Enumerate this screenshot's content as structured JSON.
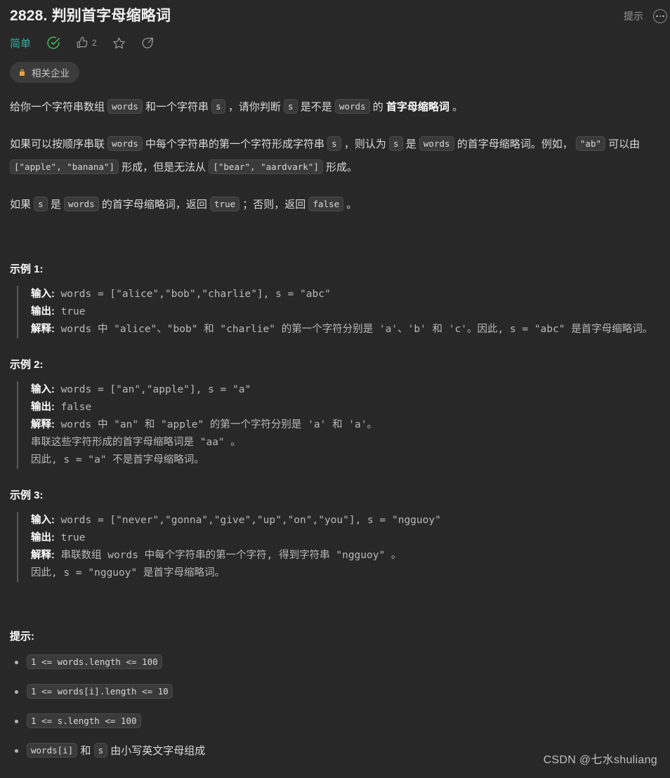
{
  "header": {
    "title": "2828. 判别首字母缩略词",
    "hint_label": "提示",
    "more_icon": "more-dots-icon"
  },
  "meta": {
    "difficulty": "简单",
    "solved_icon": "check-circle-icon",
    "like_icon": "thumbs-up-icon",
    "like_count": "2",
    "favorite_icon": "star-icon",
    "share_icon": "share-icon"
  },
  "company_tag": {
    "lock_icon": "lock-icon",
    "label": "相关企业"
  },
  "description": {
    "p1": {
      "t1": "给你一个字符串数组 ",
      "c1": "words",
      "t2": " 和一个字符串 ",
      "c2": "s",
      "t3": " ，请你判断 ",
      "c3": "s",
      "t4": " 是不是 ",
      "c4": "words",
      "t5": " 的 ",
      "bold": "首字母缩略词",
      "t6": " 。"
    },
    "p2": {
      "t1": "如果可以按顺序串联 ",
      "c1": "words",
      "t2": " 中每个字符串的第一个字符形成字符串 ",
      "c2": "s",
      "t3": " ，则认为 ",
      "c3": "s",
      "t4": " 是 ",
      "c4": "words",
      "t5": " 的首字母缩略词。例如， ",
      "c5": "\"ab\"",
      "t6": " 可以由 ",
      "c6": "[\"apple\", \"banana\"]",
      "t7": " 形成，但是无法从 ",
      "c7": "[\"bear\", \"aardvark\"]",
      "t8": " 形成。"
    },
    "p3": {
      "t1": "如果 ",
      "c1": "s",
      "t2": " 是 ",
      "c2": "words",
      "t3": " 的首字母缩略词，返回 ",
      "c3": "true",
      "t4": " ；否则，返回 ",
      "c4": "false",
      "t5": " 。"
    }
  },
  "examples": [
    {
      "title": "示例 1:",
      "input_label": "输入:",
      "input_value": " words = [\"alice\",\"bob\",\"charlie\"], s = \"abc\"",
      "output_label": "输出:",
      "output_value": " true",
      "explain_label": "解释:",
      "explain_value": " words 中 \"alice\"、\"bob\" 和 \"charlie\" 的第一个字符分别是 'a'、'b' 和 'c'。因此, s = \"abc\" 是首字母缩略词。"
    },
    {
      "title": "示例 2:",
      "input_label": "输入:",
      "input_value": " words = [\"an\",\"apple\"], s = \"a\"",
      "output_label": "输出:",
      "output_value": " false",
      "explain_label": "解释:",
      "explain_value": " words 中 \"an\" 和 \"apple\" 的第一个字符分别是 'a' 和 'a'。\n串联这些字符形成的首字母缩略词是 \"aa\" 。\n因此, s = \"a\" 不是首字母缩略词。"
    },
    {
      "title": "示例 3:",
      "input_label": "输入:",
      "input_value": " words = [\"never\",\"gonna\",\"give\",\"up\",\"on\",\"you\"], s = \"ngguoy\"",
      "output_label": "输出:",
      "output_value": " true",
      "explain_label": "解释:",
      "explain_value": " 串联数组 words 中每个字符串的第一个字符, 得到字符串 \"ngguoy\" 。\n因此, s = \"ngguoy\" 是首字母缩略词。"
    }
  ],
  "hints_section": {
    "title": "提示:",
    "items": [
      {
        "code": "1 <= words.length <= 100",
        "text": ""
      },
      {
        "code": "1 <= words[i].length <= 10",
        "text": ""
      },
      {
        "code": "1 <= s.length <= 100",
        "text": ""
      },
      {
        "code": "words[i]",
        "text_mid": " 和 ",
        "code2": "s",
        "text": " 由小写英文字母组成"
      }
    ]
  },
  "watermark": "CSDN @七水shuliang",
  "colors": {
    "background": "#282828",
    "difficulty": "#2bb3a3",
    "solved_check": "#3fbf5f",
    "lock": "#e8a33d",
    "code_bg": "#3a3a3a"
  }
}
